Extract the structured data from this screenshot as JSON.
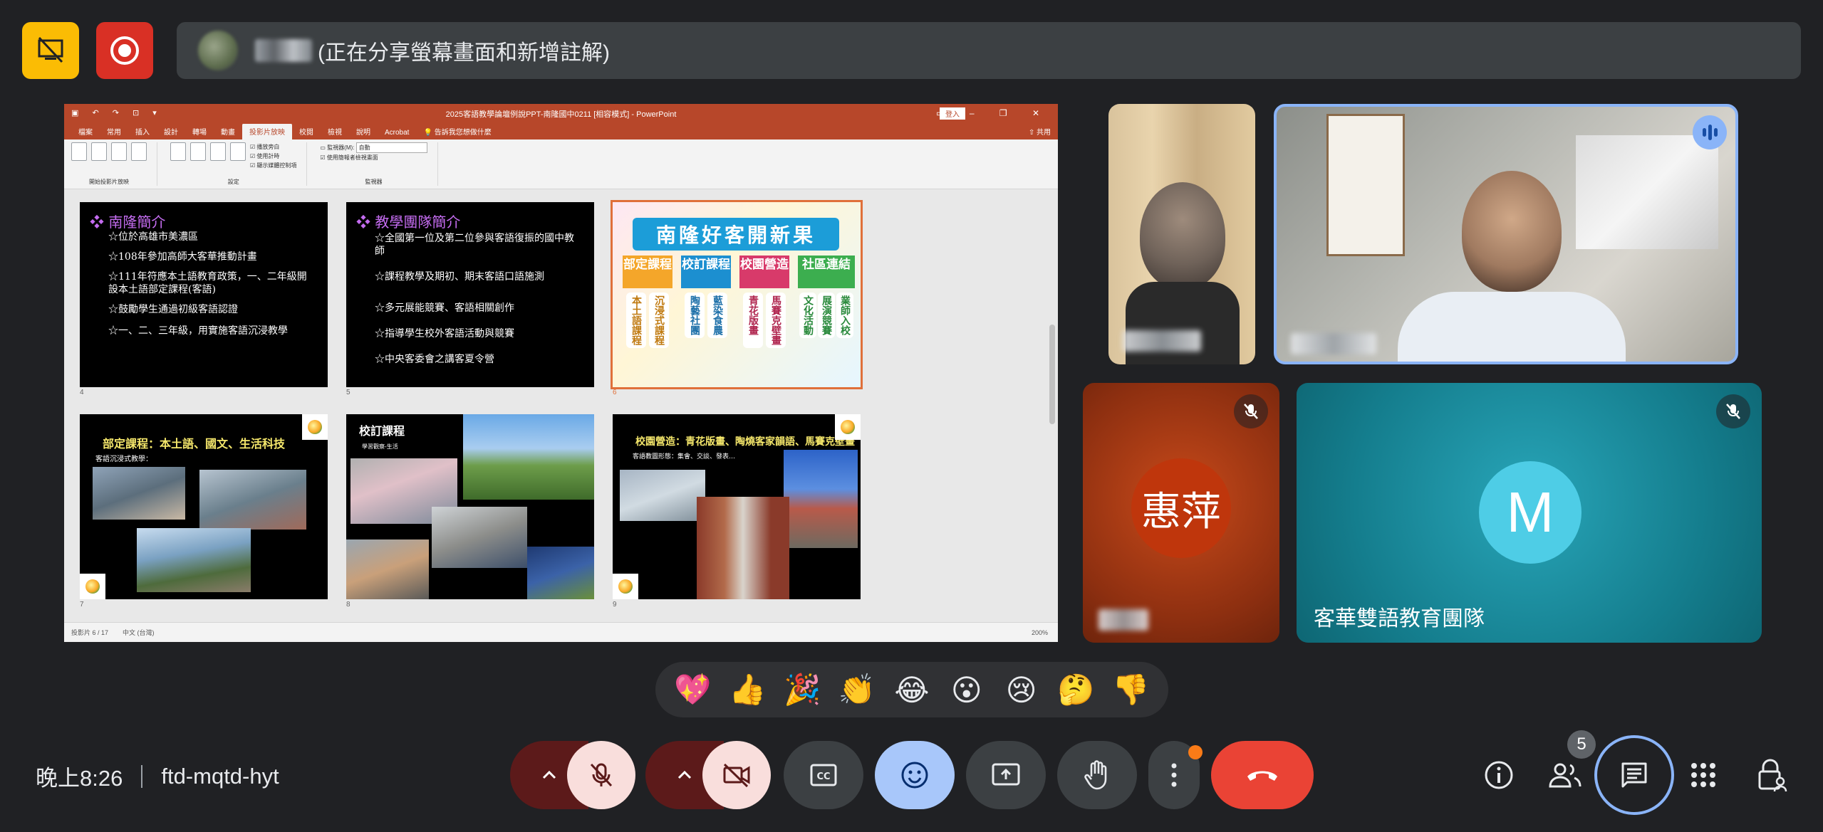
{
  "banner": {
    "text": "(正在分享螢幕畫面和新增註解)"
  },
  "colors": {
    "record_red": "#d93025",
    "yellow_btn": "#fbbc04",
    "end_call": "#ea4335",
    "accent_blue": "#8ab4f8"
  },
  "presentation": {
    "window_title": "2025客語教學論壇例說PPT-南隆國中0211 [相容模式] - PowerPoint",
    "sign_in": "登入",
    "tabs": [
      "檔案",
      "常用",
      "插入",
      "設計",
      "轉場",
      "動畫",
      "投影片放映",
      "校閱",
      "檢視",
      "說明",
      "Acrobat"
    ],
    "active_tab": "投影片放映",
    "search": "告訴我您想做什麼",
    "share": "共用",
    "ribbon": {
      "group1": "開始投影片放映",
      "group2": "設定",
      "group3": "監視器",
      "checks": [
        "播放旁白",
        "使用計時",
        "顯示媒體控制項"
      ],
      "monitor_label": "監視器(M):",
      "monitor_value": "自動",
      "presenter": "使用簡報者檢視畫面"
    },
    "status_left": "投影片 6 / 17",
    "status_lang": "中文 (台灣)",
    "zoom": "200%",
    "slides": [
      {
        "num": "4",
        "heading": "❖ 南隆簡介",
        "lines": [
          "☆位於高雄市美濃區",
          "☆108年參加高師大客華推動計畫",
          "☆111年符應本土語教育政策，一、二年級開設本土語部定課程(客語)",
          "☆鼓勵學生通過初級客語認證",
          "☆一、二、三年級，用實施客語沉浸教學"
        ]
      },
      {
        "num": "5",
        "heading": "❖ 教學團隊簡介",
        "lines": [
          "☆全國第一位及第二位參與客語復振的國中教師",
          "☆課程教學及期初、期末客語口語施測",
          "☆多元展能競賽、客語相關創作",
          "☆指導學生校外客語活動與競賽",
          "☆中央客委會之講客夏令營"
        ]
      },
      {
        "num": "6",
        "title": "南隆好客開新果",
        "columns": [
          {
            "head": "部定課程",
            "items": [
              "本土語課程",
              "沉浸式課程"
            ]
          },
          {
            "head": "校訂課程",
            "items": [
              "陶藝社團",
              "藍染食農"
            ]
          },
          {
            "head": "校園營造",
            "items": [
              "青花版畫",
              "馬賽克壁畫"
            ]
          },
          {
            "head": "社區連結",
            "items": [
              "文化活動",
              "展演競賽",
              "業師入校"
            ]
          }
        ]
      },
      {
        "num": "7",
        "heading": "部定課程：本土語、國文、生活科技",
        "sub": "客語沉浸式教學："
      },
      {
        "num": "8",
        "heading": "校訂課程",
        "sub": "學習觀察-生活"
      },
      {
        "num": "9",
        "heading": "校園營造：青花版畫、陶燒客家韻語、馬賽克壁畫",
        "sub": "客語教圖形態：集會、交談、發表…"
      }
    ]
  },
  "participants": [
    {
      "id": "p1",
      "speaking": false
    },
    {
      "id": "p2",
      "speaking": true
    },
    {
      "id": "p3",
      "avatar_text": "惠萍",
      "muted": true,
      "color": "#bf360c"
    },
    {
      "id": "p4",
      "avatar_text": "M",
      "name": "客華雙語教育團隊",
      "muted": true,
      "color": "#4ecde6"
    }
  ],
  "reactions": [
    "💖",
    "👍",
    "🎉",
    "👏",
    "😂",
    "😮",
    "😢",
    "🤔",
    "👎"
  ],
  "bottom": {
    "time": "晚上8:26",
    "meeting_code": "ftd-mqtd-hyt",
    "people_count": "5"
  }
}
